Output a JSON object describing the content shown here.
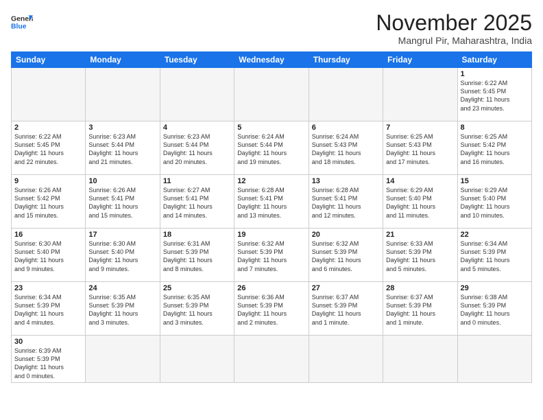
{
  "header": {
    "logo_general": "General",
    "logo_blue": "Blue",
    "month_title": "November 2025",
    "location": "Mangrul Pir, Maharashtra, India"
  },
  "weekdays": [
    "Sunday",
    "Monday",
    "Tuesday",
    "Wednesday",
    "Thursday",
    "Friday",
    "Saturday"
  ],
  "weeks": [
    [
      {
        "day": "",
        "info": ""
      },
      {
        "day": "",
        "info": ""
      },
      {
        "day": "",
        "info": ""
      },
      {
        "day": "",
        "info": ""
      },
      {
        "day": "",
        "info": ""
      },
      {
        "day": "",
        "info": ""
      },
      {
        "day": "1",
        "info": "Sunrise: 6:22 AM\nSunset: 5:45 PM\nDaylight: 11 hours\nand 23 minutes."
      }
    ],
    [
      {
        "day": "2",
        "info": "Sunrise: 6:22 AM\nSunset: 5:45 PM\nDaylight: 11 hours\nand 22 minutes."
      },
      {
        "day": "3",
        "info": "Sunrise: 6:23 AM\nSunset: 5:44 PM\nDaylight: 11 hours\nand 21 minutes."
      },
      {
        "day": "4",
        "info": "Sunrise: 6:23 AM\nSunset: 5:44 PM\nDaylight: 11 hours\nand 20 minutes."
      },
      {
        "day": "5",
        "info": "Sunrise: 6:24 AM\nSunset: 5:44 PM\nDaylight: 11 hours\nand 19 minutes."
      },
      {
        "day": "6",
        "info": "Sunrise: 6:24 AM\nSunset: 5:43 PM\nDaylight: 11 hours\nand 18 minutes."
      },
      {
        "day": "7",
        "info": "Sunrise: 6:25 AM\nSunset: 5:43 PM\nDaylight: 11 hours\nand 17 minutes."
      },
      {
        "day": "8",
        "info": "Sunrise: 6:25 AM\nSunset: 5:42 PM\nDaylight: 11 hours\nand 16 minutes."
      }
    ],
    [
      {
        "day": "9",
        "info": "Sunrise: 6:26 AM\nSunset: 5:42 PM\nDaylight: 11 hours\nand 15 minutes."
      },
      {
        "day": "10",
        "info": "Sunrise: 6:26 AM\nSunset: 5:41 PM\nDaylight: 11 hours\nand 15 minutes."
      },
      {
        "day": "11",
        "info": "Sunrise: 6:27 AM\nSunset: 5:41 PM\nDaylight: 11 hours\nand 14 minutes."
      },
      {
        "day": "12",
        "info": "Sunrise: 6:28 AM\nSunset: 5:41 PM\nDaylight: 11 hours\nand 13 minutes."
      },
      {
        "day": "13",
        "info": "Sunrise: 6:28 AM\nSunset: 5:41 PM\nDaylight: 11 hours\nand 12 minutes."
      },
      {
        "day": "14",
        "info": "Sunrise: 6:29 AM\nSunset: 5:40 PM\nDaylight: 11 hours\nand 11 minutes."
      },
      {
        "day": "15",
        "info": "Sunrise: 6:29 AM\nSunset: 5:40 PM\nDaylight: 11 hours\nand 10 minutes."
      }
    ],
    [
      {
        "day": "16",
        "info": "Sunrise: 6:30 AM\nSunset: 5:40 PM\nDaylight: 11 hours\nand 9 minutes."
      },
      {
        "day": "17",
        "info": "Sunrise: 6:30 AM\nSunset: 5:40 PM\nDaylight: 11 hours\nand 9 minutes."
      },
      {
        "day": "18",
        "info": "Sunrise: 6:31 AM\nSunset: 5:39 PM\nDaylight: 11 hours\nand 8 minutes."
      },
      {
        "day": "19",
        "info": "Sunrise: 6:32 AM\nSunset: 5:39 PM\nDaylight: 11 hours\nand 7 minutes."
      },
      {
        "day": "20",
        "info": "Sunrise: 6:32 AM\nSunset: 5:39 PM\nDaylight: 11 hours\nand 6 minutes."
      },
      {
        "day": "21",
        "info": "Sunrise: 6:33 AM\nSunset: 5:39 PM\nDaylight: 11 hours\nand 5 minutes."
      },
      {
        "day": "22",
        "info": "Sunrise: 6:34 AM\nSunset: 5:39 PM\nDaylight: 11 hours\nand 5 minutes."
      }
    ],
    [
      {
        "day": "23",
        "info": "Sunrise: 6:34 AM\nSunset: 5:39 PM\nDaylight: 11 hours\nand 4 minutes."
      },
      {
        "day": "24",
        "info": "Sunrise: 6:35 AM\nSunset: 5:39 PM\nDaylight: 11 hours\nand 3 minutes."
      },
      {
        "day": "25",
        "info": "Sunrise: 6:35 AM\nSunset: 5:39 PM\nDaylight: 11 hours\nand 3 minutes."
      },
      {
        "day": "26",
        "info": "Sunrise: 6:36 AM\nSunset: 5:39 PM\nDaylight: 11 hours\nand 2 minutes."
      },
      {
        "day": "27",
        "info": "Sunrise: 6:37 AM\nSunset: 5:39 PM\nDaylight: 11 hours\nand 1 minute."
      },
      {
        "day": "28",
        "info": "Sunrise: 6:37 AM\nSunset: 5:39 PM\nDaylight: 11 hours\nand 1 minute."
      },
      {
        "day": "29",
        "info": "Sunrise: 6:38 AM\nSunset: 5:39 PM\nDaylight: 11 hours\nand 0 minutes."
      }
    ],
    [
      {
        "day": "30",
        "info": "Sunrise: 6:39 AM\nSunset: 5:39 PM\nDaylight: 11 hours\nand 0 minutes."
      },
      {
        "day": "",
        "info": ""
      },
      {
        "day": "",
        "info": ""
      },
      {
        "day": "",
        "info": ""
      },
      {
        "day": "",
        "info": ""
      },
      {
        "day": "",
        "info": ""
      },
      {
        "day": "",
        "info": ""
      }
    ]
  ]
}
